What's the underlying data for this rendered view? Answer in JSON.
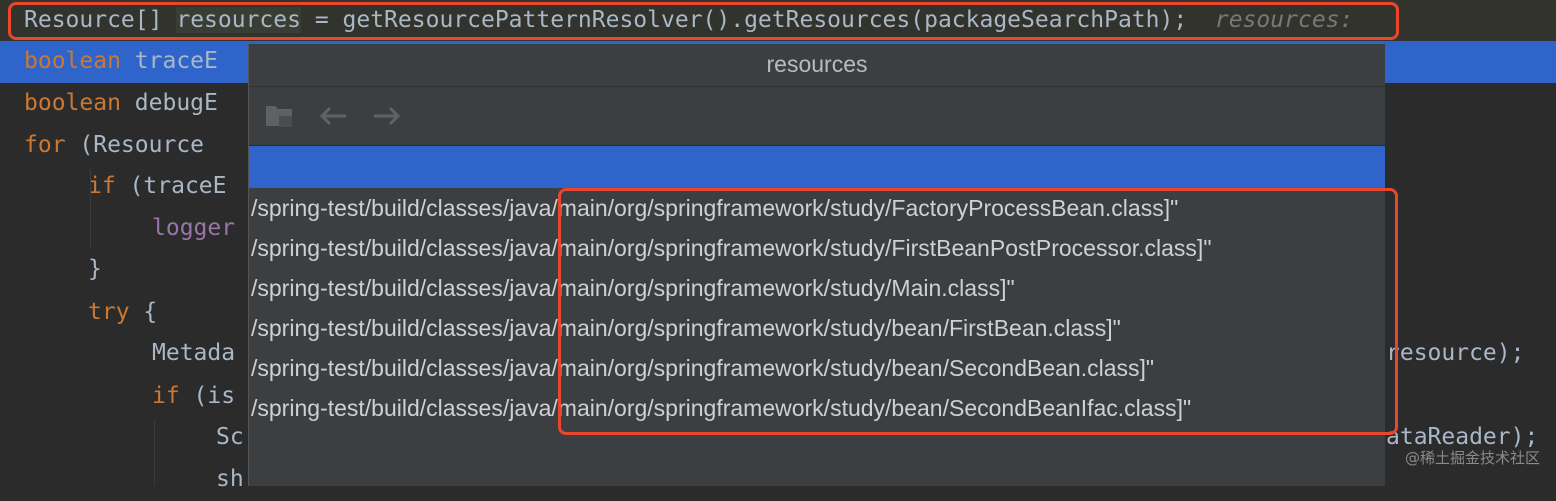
{
  "editor": {
    "line1": {
      "type": "Resource[]",
      "var": "resources",
      "rest": " = getResourcePatternResolver().getResources(packageSearchPath);",
      "inlay_hint": "resources:"
    },
    "line2": {
      "kw": "boolean",
      "text": " traceE"
    },
    "line3": {
      "kw": "boolean",
      "text": " debugE"
    },
    "line4": {
      "kw": "for",
      "text": " (Resource"
    },
    "line5": {
      "kw": "if",
      "text": " (traceE"
    },
    "line6": {
      "ident": "logger"
    },
    "line7": {
      "text": "}"
    },
    "line8": {
      "kw": "try",
      "text": " {"
    },
    "line9": {
      "text": "Metada",
      "right": "resource);"
    },
    "line10": {
      "kw": "if",
      "text": " (is"
    },
    "line11": {
      "text": "Sc",
      "right": "ataReader);"
    },
    "line12": {
      "text": "sh"
    }
  },
  "popup": {
    "title": "resources",
    "toolbar": {
      "icons": [
        "folder-icon",
        "back-arrow-icon",
        "forward-arrow-icon"
      ]
    },
    "rows": [
      "/spring-test/build/classes/java/main/org/springframework/study/FactoryProcessBean.class]\"",
      "/spring-test/build/classes/java/main/org/springframework/study/FirstBeanPostProcessor.class]\"",
      "/spring-test/build/classes/java/main/org/springframework/study/Main.class]\"",
      "/spring-test/build/classes/java/main/org/springframework/study/bean/FirstBean.class]\"",
      "/spring-test/build/classes/java/main/org/springframework/study/bean/SecondBean.class]\"",
      "/spring-test/build/classes/java/main/org/springframework/study/bean/SecondBeanIfac.class]\""
    ]
  },
  "watermark": "@稀土掘金技术社区",
  "colors": {
    "highlight": "#e8472e",
    "selection": "#2f65ca",
    "keyword": "#cc7832"
  }
}
